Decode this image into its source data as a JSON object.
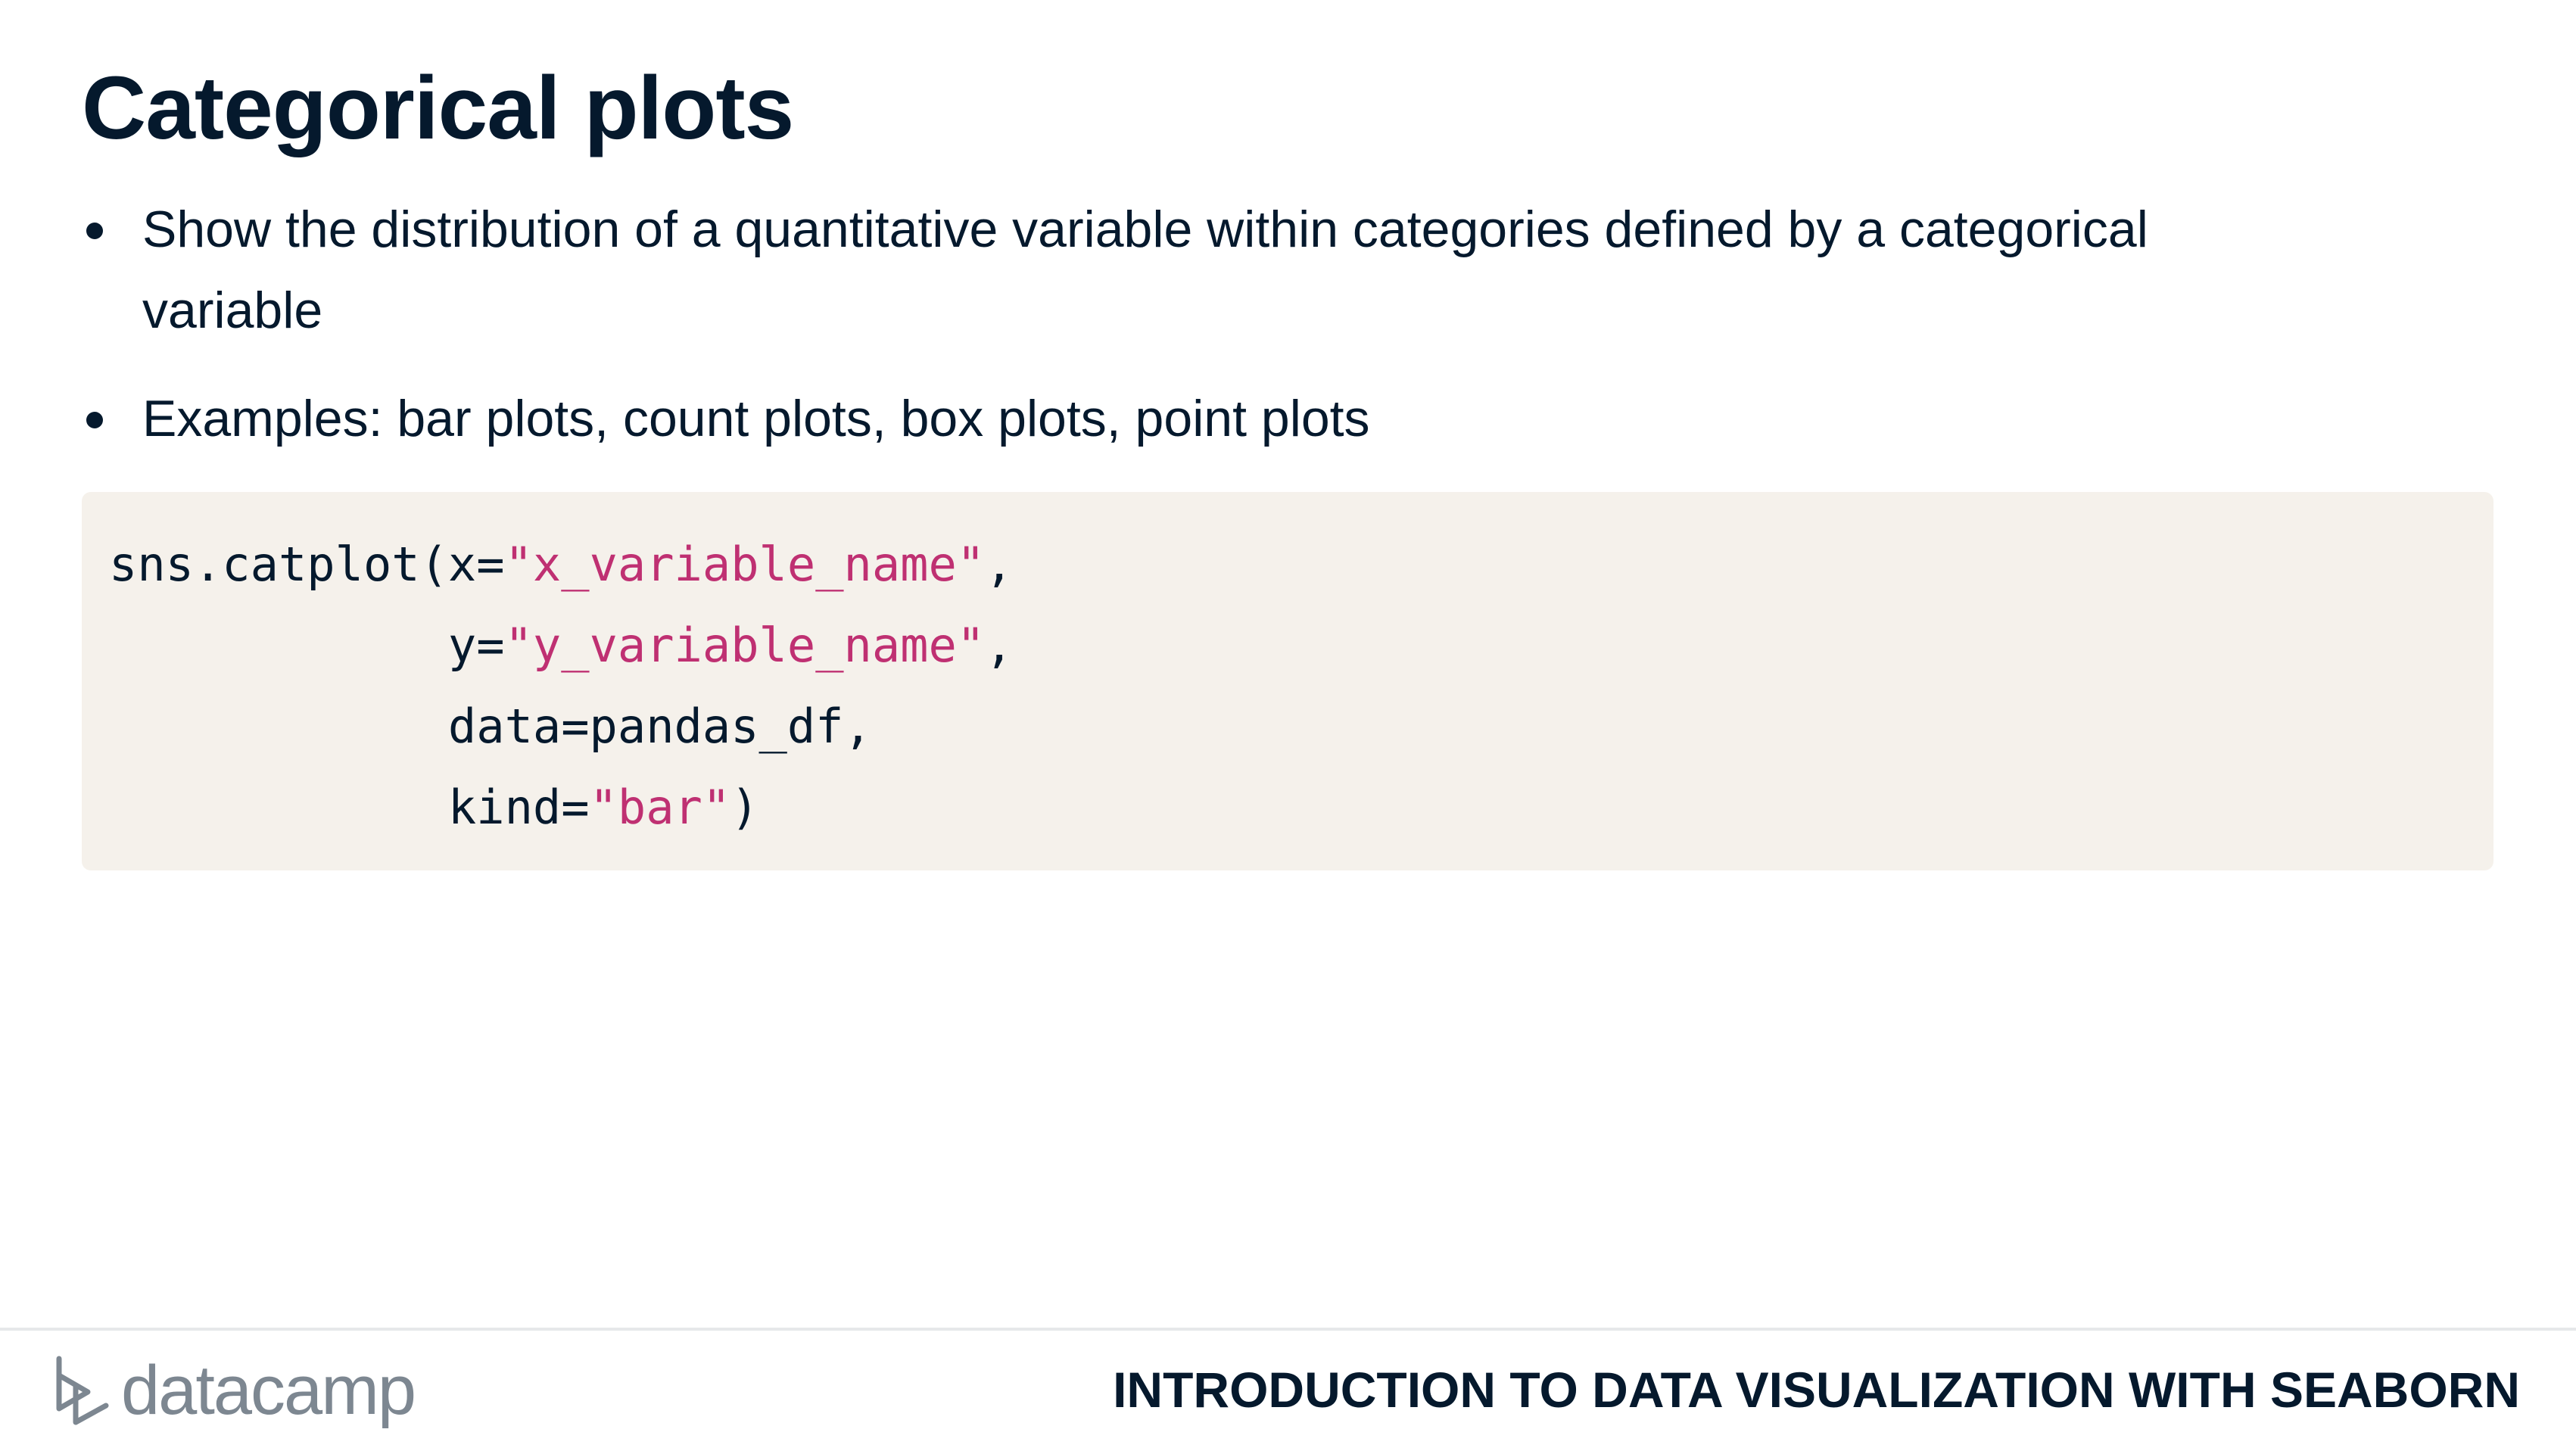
{
  "slide": {
    "title": "Categorical plots",
    "bullets": [
      {
        "line1": "Show the distribution of a quantitative variable within categories defined by a categorical",
        "line2": "variable"
      },
      {
        "line1": "Examples: bar plots, count plots, box plots, point plots"
      }
    ]
  },
  "code": {
    "lines": [
      {
        "pre": "sns.catplot(x=",
        "str": "\"x_variable_name\"",
        "post": ","
      },
      {
        "pre": "            y=",
        "str": "\"y_variable_name\"",
        "post": ","
      },
      {
        "pre": "            data=pandas_df,",
        "str": "",
        "post": ""
      },
      {
        "pre": "            kind=",
        "str": "\"bar\"",
        "post": ")"
      }
    ],
    "colors": {
      "text": "#05192d",
      "string": "#bf3072",
      "background": "#f5f1eb"
    }
  },
  "footer": {
    "logo_text": "datacamp",
    "logo_icon": "datacamp-logo-icon",
    "course_name": "INTRODUCTION TO DATA VISUALIZATION WITH SEABORN"
  }
}
